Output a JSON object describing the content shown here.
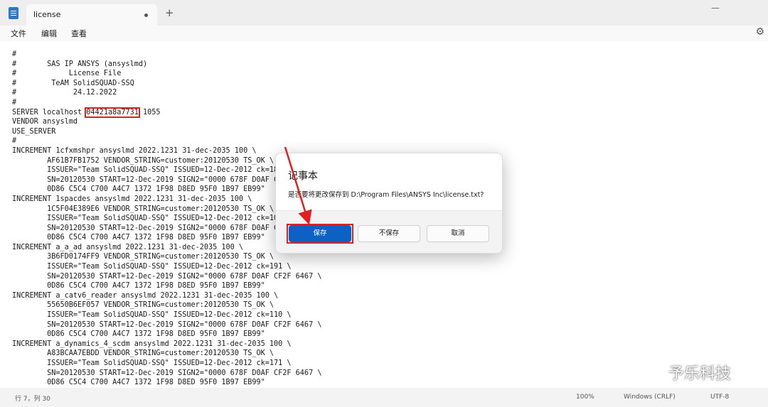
{
  "window": {
    "tab_title": "license",
    "new_tab_symbol": "+",
    "minimize_symbol": "—"
  },
  "menu": {
    "file": "文件",
    "edit": "编辑",
    "view": "查看"
  },
  "editor": {
    "lines": [
      "#",
      "#       SAS IP ANSYS (ansyslmd)",
      "#            License File",
      "#        TeAM SolidSQUAD-SSQ",
      "#             24.12.2022",
      "#",
      "SERVER localhost ",
      "VENDOR ansyslmd",
      "USE_SERVER",
      "#",
      "INCREMENT 1cfxmshpr ansyslmd 2022.1231 31-dec-2035 100 \\",
      "        AF61B7FB1752 VENDOR_STRING=customer:20120530 TS_OK \\",
      "        ISSUER=\"Team SolidSQUAD-SSQ\" ISSUED=12-Dec-2012 ck=18",
      "        SN=20120530 START=12-Dec-2019 SIGN2=\"0000 678F D0AF C",
      "        0D86 C5C4 C700 A4C7 1372 1F98 D8ED 95F0 1B97 EB99\"",
      "INCREMENT 1spacdes ansyslmd 2022.1231 31-dec-2035 100 \\",
      "        1C5F04E389E6 VENDOR_STRING=customer:20120530 TS_OK \\",
      "        ISSUER=\"Team SolidSQUAD-SSQ\" ISSUED=12-Dec-2012 ck=10",
      "        SN=20120530 START=12-Dec-2019 SIGN2=\"0000 678F D0AF C",
      "        0D86 C5C4 C700 A4C7 1372 1F98 D8ED 95F0 1B97 EB99\"",
      "INCREMENT a_a_ad ansyslmd 2022.1231 31-dec-2035 100 \\",
      "        3B6FD0174FF9 VENDOR_STRING=customer:20120530 TS_OK \\",
      "        ISSUER=\"Team SolidSQUAD-SSQ\" ISSUED=12-Dec-2012 ck=191 \\",
      "        SN=20120530 START=12-Dec-2019 SIGN2=\"0000 678F D0AF CF2F 6467 \\",
      "        0D86 C5C4 C700 A4C7 1372 1F98 D8ED 95F0 1B97 EB99\"",
      "INCREMENT a_catv6_reader ansyslmd 2022.1231 31-dec-2035 100 \\",
      "        55650B6EF057 VENDOR_STRING=customer:20120530 TS_OK \\",
      "        ISSUER=\"Team SolidSQUAD-SSQ\" ISSUED=12-Dec-2012 ck=110 \\",
      "        SN=20120530 START=12-Dec-2019 SIGN2=\"0000 678F D0AF CF2F 6467 \\",
      "        0D86 C5C4 C700 A4C7 1372 1F98 D8ED 95F0 1B97 EB99\"",
      "INCREMENT a_dynamics_4_scdm ansyslmd 2022.1231 31-dec-2035 100 \\",
      "        A83BCAA7EBDD VENDOR_STRING=customer:20120530 TS_OK \\",
      "        ISSUER=\"Team SolidSQUAD-SSQ\" ISSUED=12-Dec-2012 ck=171 \\",
      "        SN=20120530 START=12-Dec-2019 SIGN2=\"0000 678F D0AF CF2F 6467 \\",
      "        0D86 C5C4 C700 A4C7 1372 1F98 D8ED 95F0 1B97 EB99\""
    ],
    "server_hostid": "04421a8a7731",
    "server_port": " 1055"
  },
  "status": {
    "position": "行 7，列 30",
    "zoom": "100%",
    "line_ending": "Windows (CRLF)",
    "encoding": "UTF-8"
  },
  "dialog": {
    "title": "记事本",
    "message": "是否要将更改保存到 D:\\Program Files\\ANSYS Inc\\license.txt?",
    "save": "保存",
    "dont_save": "不保存",
    "cancel": "取消"
  },
  "watermark": {
    "text": "予乐科技"
  },
  "colors": {
    "accent": "#0b62c2",
    "annotation": "#e02020"
  }
}
